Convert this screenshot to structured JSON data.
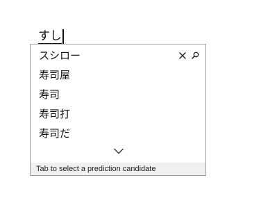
{
  "composition": {
    "text": "すし"
  },
  "candidates": [
    {
      "label": "スシロー"
    },
    {
      "label": "寿司屋"
    },
    {
      "label": "寿司"
    },
    {
      "label": "寿司打"
    },
    {
      "label": "寿司だ"
    }
  ],
  "actions": {
    "close_icon": "close-icon",
    "search_icon": "search-icon",
    "expand_icon": "chevron-down-icon"
  },
  "status": {
    "hint": "Tab to select a prediction candidate"
  }
}
